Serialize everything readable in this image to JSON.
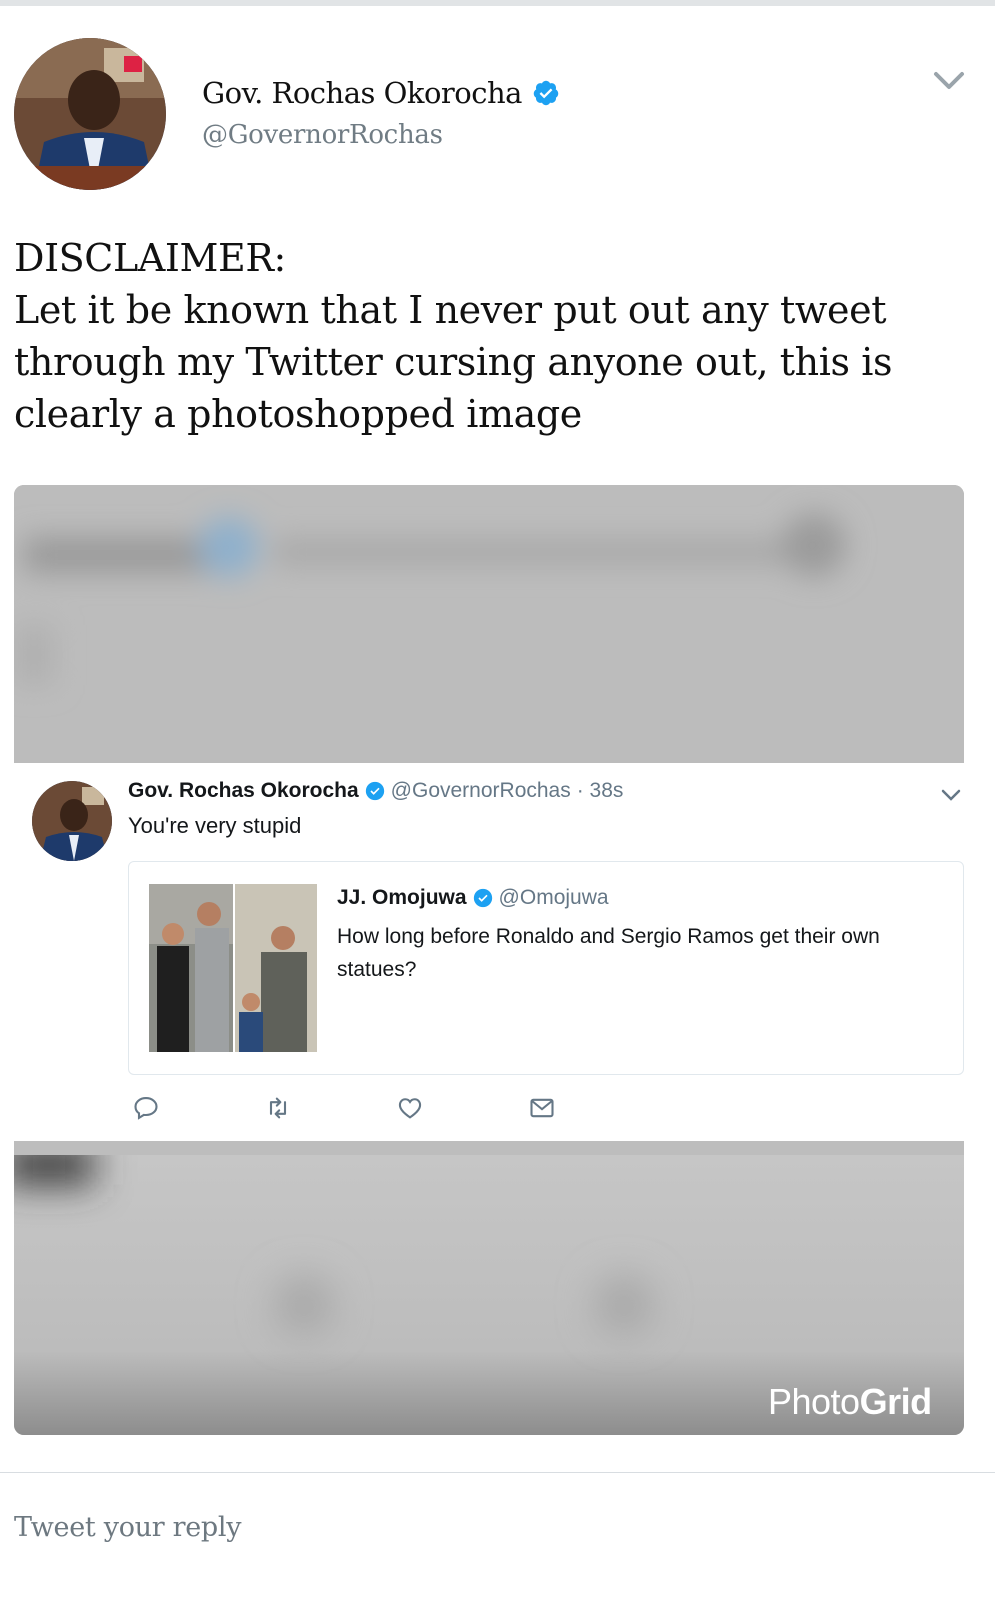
{
  "tweet": {
    "author_name": "Gov. Rochas Okorocha",
    "author_handle": "@GovernorRochas",
    "text": "DISCLAIMER:\nLet it be known that I never put out any tweet through my Twitter cursing anyone out, this is clearly a photoshopped image"
  },
  "embedded_tweet": {
    "author_name": "Gov. Rochas Okorocha",
    "author_handle": "@GovernorRochas",
    "time": "· 38s",
    "text": "You're very stupid",
    "quoted": {
      "author_name": "JJ. Omojuwa",
      "author_handle": "@Omojuwa",
      "text": "How long  before Ronaldo and Sergio Ramos get their own statues?"
    }
  },
  "watermark": {
    "part1": "Photo",
    "part2": "Grid"
  },
  "reply": {
    "placeholder": "Tweet your reply"
  },
  "colors": {
    "verified": "#1da1f2",
    "handle": "#707c84",
    "blur": "#bebebe"
  },
  "icons": [
    "verified-icon",
    "chevron-down-icon",
    "reply-icon",
    "retweet-icon",
    "like-icon",
    "message-icon"
  ]
}
